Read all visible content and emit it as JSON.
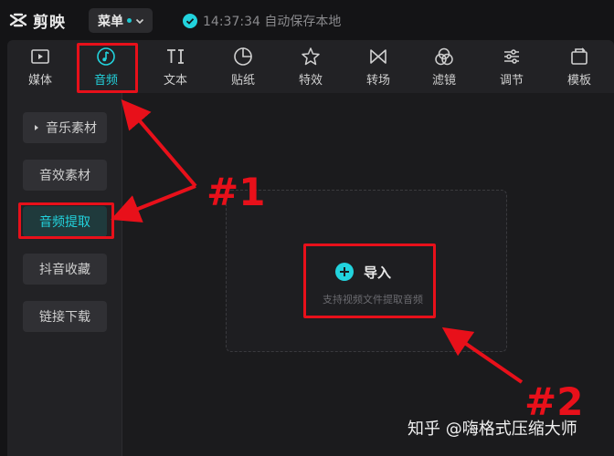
{
  "app": {
    "name": "剪映"
  },
  "menu": {
    "label": "菜单"
  },
  "save_status": {
    "text": "14:37:34 自动保存本地"
  },
  "toolbar": {
    "items": [
      {
        "label": "媒体",
        "icon": "media-icon"
      },
      {
        "label": "音频",
        "icon": "audio-icon",
        "active": true
      },
      {
        "label": "文本",
        "icon": "text-icon"
      },
      {
        "label": "贴纸",
        "icon": "sticker-icon"
      },
      {
        "label": "特效",
        "icon": "effects-icon"
      },
      {
        "label": "转场",
        "icon": "transition-icon"
      },
      {
        "label": "滤镜",
        "icon": "filter-icon"
      },
      {
        "label": "调节",
        "icon": "adjust-icon"
      },
      {
        "label": "模板",
        "icon": "template-icon"
      }
    ]
  },
  "sidebar": {
    "items": [
      {
        "label": "音乐素材"
      },
      {
        "label": "音效素材"
      },
      {
        "label": "音频提取",
        "active": true
      },
      {
        "label": "抖音收藏"
      },
      {
        "label": "链接下载"
      }
    ]
  },
  "dropzone": {
    "import_label": "导入",
    "hint": "支持视频文件提取音频"
  },
  "annotations": {
    "first": "#1",
    "second": "#2"
  },
  "watermark": {
    "text": "知乎 @嗨格式压缩大师"
  },
  "colors": {
    "accent": "#22d3dd",
    "annotation": "#e8101a",
    "background": "#141416"
  }
}
